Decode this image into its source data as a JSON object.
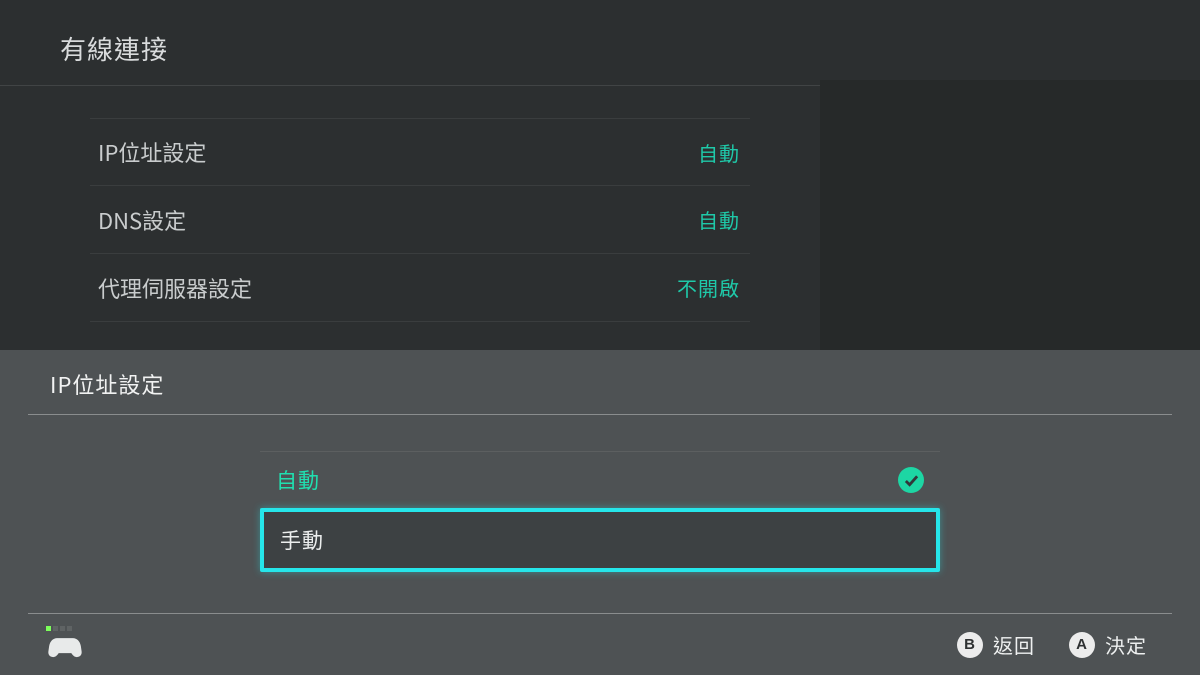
{
  "page": {
    "title": "有線連接",
    "rows": [
      {
        "label": "IP位址設定",
        "value": "自動"
      },
      {
        "label": "DNS設定",
        "value": "自動"
      },
      {
        "label": "代理伺服器設定",
        "value": "不開啟"
      }
    ]
  },
  "dialog": {
    "title": "IP位址設定",
    "options": {
      "auto": "自動",
      "manual": "手動"
    }
  },
  "footer": {
    "back": {
      "key": "B",
      "label": "返回"
    },
    "confirm": {
      "key": "A",
      "label": "決定"
    }
  }
}
